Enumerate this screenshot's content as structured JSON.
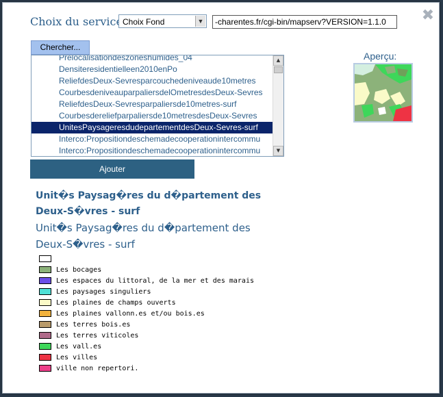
{
  "dialog": {
    "close_label": "✖"
  },
  "service": {
    "label": "Choix du service:",
    "selected": "Choix Fond",
    "url_value": "-charentes.fr/cgi-bin/mapserv?VERSION=1.1.0"
  },
  "search": {
    "label": "Chercher..."
  },
  "layers": [
    {
      "label": "Prelocalisationdeszoneshumides_04",
      "selected": false
    },
    {
      "label": "Densiteresidentielleen2010enPo",
      "selected": false
    },
    {
      "label": "ReliefdesDeux-Sevresparcouchedeniveaude10metres",
      "selected": false
    },
    {
      "label": "CourbesdeniveauparpaliersdelOmetresdesDeux-Sevres",
      "selected": false
    },
    {
      "label": "ReliefdesDeux-Sevresparpaliersde10metres-surf",
      "selected": false
    },
    {
      "label": "Courbesdereliefparpaliersde10metresdesDeux-Sevres",
      "selected": false
    },
    {
      "label": "UnitesPaysageresdudepartementdesDeux-Sevres-surf",
      "selected": true
    },
    {
      "label": "Interco:Propositiondeschemadecooperationintercommu",
      "selected": false
    },
    {
      "label": "Interco:Propositiondeschemadecooperationintercommu",
      "selected": false
    }
  ],
  "preview": {
    "label": "Aperçu:"
  },
  "add_button": {
    "label": "Ajouter"
  },
  "legend": {
    "title_bold": "Unit�s Paysag�res du d�partement des Deux-S�vres - surf",
    "title_normal": "Unit�s Paysag�res du d�partement des Deux-S�vres - surf",
    "items": [
      {
        "label": "",
        "color": "#ffffff"
      },
      {
        "label": "Les bocages",
        "color": "#8cb27a"
      },
      {
        "label": "Les espaces du littoral, de la mer et des marais",
        "color": "#6b4fe8"
      },
      {
        "label": "Les paysages singuliers",
        "color": "#4fe0d6"
      },
      {
        "label": "Les plaines de champs ouverts",
        "color": "#fafac8"
      },
      {
        "label": "Les plaines vallonn.es et/ou bois.es",
        "color": "#f2b23c"
      },
      {
        "label": "Les terres bois.es",
        "color": "#b89a6a"
      },
      {
        "label": "Les terres viticoles",
        "color": "#b06a8a"
      },
      {
        "label": "Les vall.es",
        "color": "#3ed75a"
      },
      {
        "label": "Les villes",
        "color": "#ee3344"
      },
      {
        "label": "ville non repertori.",
        "color": "#ee3f8a"
      }
    ]
  }
}
